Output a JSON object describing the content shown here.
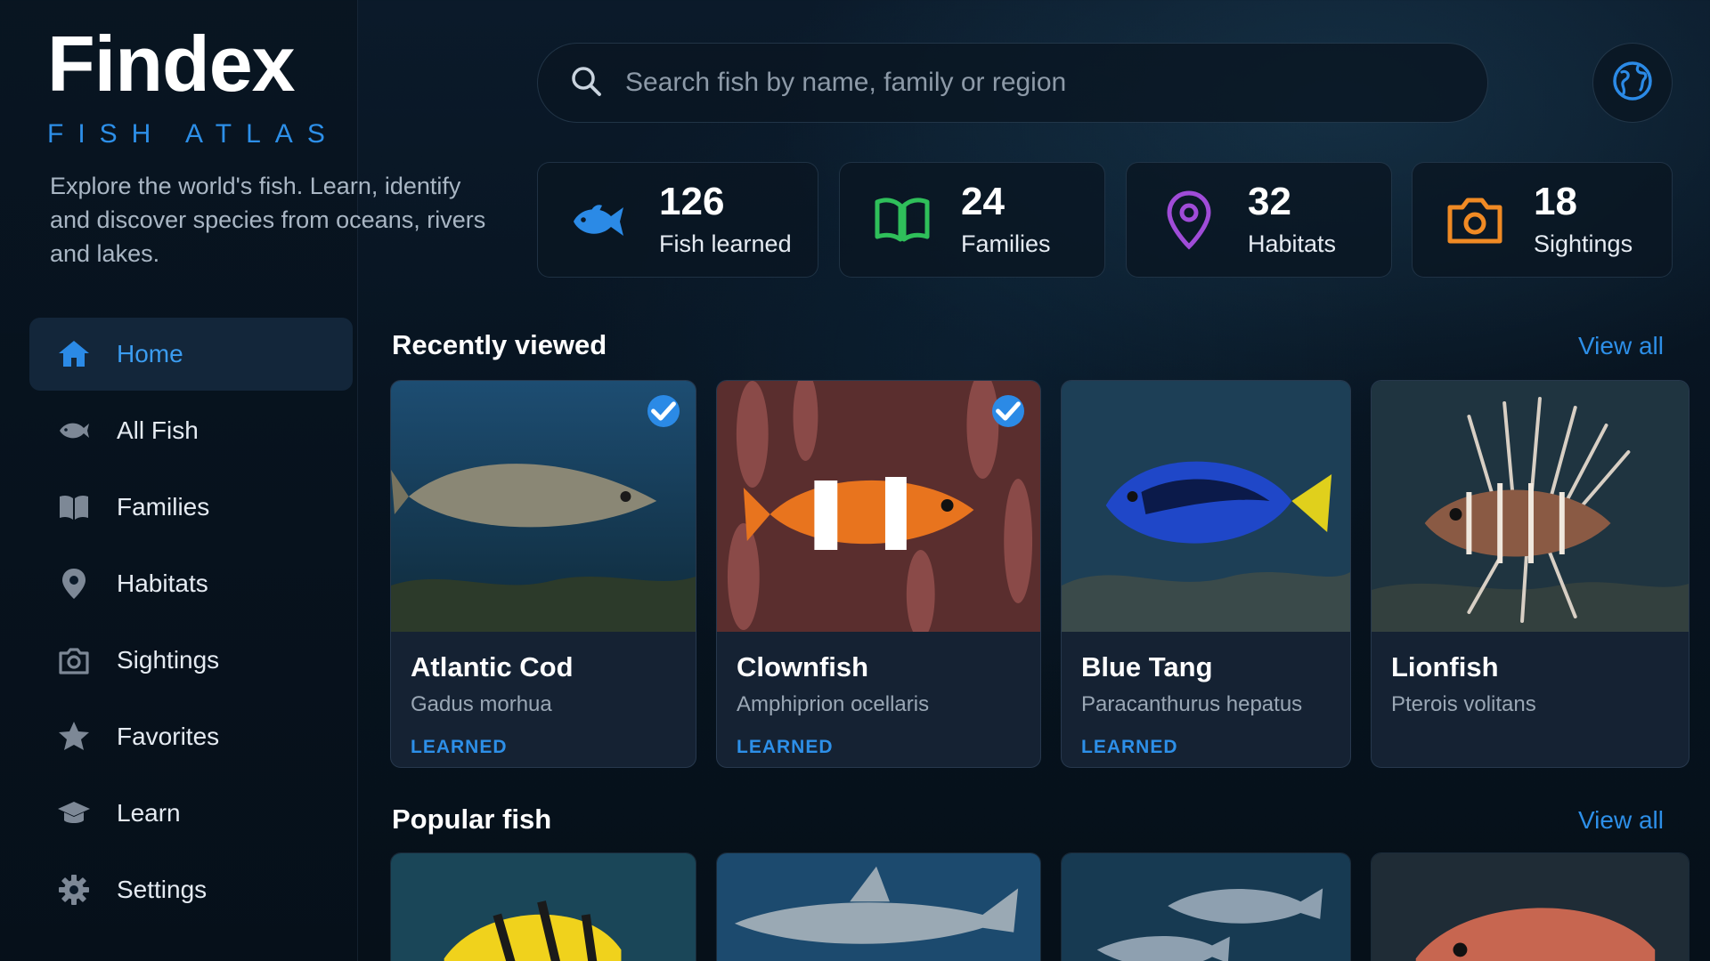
{
  "app": {
    "name": "Findex",
    "subtitle": "FISH ATLAS",
    "tagline": "Explore the world's fish. Learn, identify and discover species from oceans, rivers and lakes."
  },
  "search": {
    "placeholder": "Search fish by name, family or region"
  },
  "stats": [
    {
      "value": "126",
      "label": "Fish learned",
      "icon": "fish-icon",
      "color": "#2b8ae6"
    },
    {
      "value": "24",
      "label": "Families",
      "icon": "book-icon",
      "color": "#2fbf5a"
    },
    {
      "value": "32",
      "label": "Habitats",
      "icon": "map-pin-icon",
      "color": "#a04cd8"
    },
    {
      "value": "18",
      "label": "Sightings",
      "icon": "camera-icon",
      "color": "#f08a24"
    }
  ],
  "nav": {
    "items": [
      {
        "label": "Home",
        "icon": "home-icon",
        "active": true
      },
      {
        "label": "All Fish",
        "icon": "fish-icon"
      },
      {
        "label": "Families",
        "icon": "book-icon"
      },
      {
        "label": "Habitats",
        "icon": "map-pin-icon"
      },
      {
        "label": "Sightings",
        "icon": "camera-icon"
      },
      {
        "label": "Favorites",
        "icon": "star-icon"
      },
      {
        "label": "Learn",
        "icon": "graduation-cap-icon"
      },
      {
        "label": "Settings",
        "icon": "gear-icon"
      }
    ]
  },
  "recent": {
    "title": "Recently viewed",
    "view_all": "View all",
    "cards": [
      {
        "name": "Atlantic Cod",
        "scientific": "Gadus morhua",
        "status": "LEARNED",
        "checked": true
      },
      {
        "name": "Clownfish",
        "scientific": "Amphiprion ocellaris",
        "status": "LEARNED",
        "checked": true
      },
      {
        "name": "Blue Tang",
        "scientific": "Paracanthurus hepatus",
        "status": "LEARNED",
        "checked": false
      },
      {
        "name": "Lionfish",
        "scientific": "Pterois volitans",
        "status": "",
        "checked": false
      }
    ]
  },
  "popular": {
    "title": "Popular fish",
    "view_all": "View all"
  },
  "colors": {
    "accent": "#2d8fe8",
    "background": "#07131f",
    "card": "#152233"
  }
}
